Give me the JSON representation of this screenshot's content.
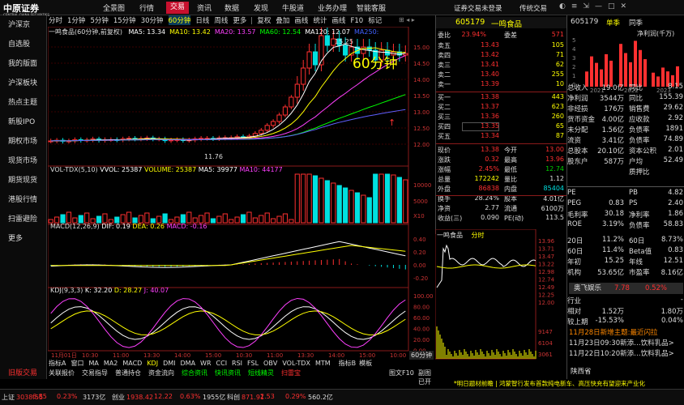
{
  "app": {
    "logo": "中原证券",
    "logo_sub": "CENTRAL CHINA SECURITIES",
    "login": "证券交易未登录",
    "sync": "传统交易"
  },
  "menu": [
    "全景图",
    "行情",
    "交易",
    "资讯",
    "数据",
    "发现",
    "牛股道",
    "业务办理",
    "智能客服"
  ],
  "menu_active": 2,
  "sidebar": [
    "沪深京",
    "自选股",
    "我的版面",
    "沪深板块",
    "热点主题",
    "新股IPO",
    "期权市场",
    "现货市场",
    "期货现货",
    "港股行情",
    "扫雷避险",
    "更多",
    "旧版交易"
  ],
  "toolbar": {
    "items": [
      "分时",
      "1分钟",
      "5分钟",
      "15分钟",
      "30分钟",
      "60分钟",
      "日线",
      "周线",
      "更多",
      "复权",
      "叠加",
      "画线",
      "统计",
      "画线",
      "F10",
      "标记"
    ],
    "selected": "60分钟"
  },
  "chart": {
    "title": "一鸣食品(60分钟,前复权)",
    "ma": [
      {
        "label": "MA5: 13.34",
        "color": "#ffffff"
      },
      {
        "label": "MA10: 13.42",
        "color": "#ffff00"
      },
      {
        "label": "MA20: 13.57",
        "color": "#ff40ff"
      },
      {
        "label": "MA60: 12.54",
        "color": "#00ff00"
      },
      {
        "label": "MA120: 12.07",
        "color": "#ffffff"
      },
      {
        "label": "MA250:",
        "color": "#4060ff"
      }
    ],
    "annotation": "60分钟",
    "high_label": "15.25",
    "low_label": "11.76",
    "y_ticks": [
      "15.00",
      "14.50",
      "14.00",
      "13.50",
      "13.00",
      "12.50",
      "12.00"
    ],
    "vol_title": "VOL-TDX(5,10)",
    "vol_vals": [
      "VVOL: 25387",
      "VOLUME: 25387",
      "MA5: 39977",
      "MA10: 44177"
    ],
    "vol_ticks": [
      "10000",
      "5000",
      "X10"
    ],
    "macd_title": "MACD(12,26,9)",
    "macd_vals": [
      "DIF: 0.19",
      "DEA: 0.26",
      "MACD: -0.16"
    ],
    "macd_ticks": [
      "0.40",
      "0.20",
      "0.00",
      "-0.20"
    ],
    "kdj_title": "KDJ(9,3,3)",
    "kdj_vals": [
      "K: 32.20",
      "D: 28.27",
      "J: 40.07"
    ],
    "kdj_ticks": [
      "100.00",
      "80.00",
      "60.00",
      "40.00",
      "20.00",
      "0.00"
    ],
    "x_labels": [
      "11月01日",
      "10:30",
      "11:00",
      "13:30",
      "14:00",
      "15:00",
      "10:30",
      "11:00",
      "13:30",
      "14:00",
      "15:00",
      "10:00"
    ],
    "period_tag": "60分钟",
    "bottom_tabs": [
      "指标A",
      "窗口",
      "MA",
      "MA2",
      "MACD",
      "KDJ",
      "DMI",
      "DMA",
      "WR",
      "CCI",
      "RSI",
      "FSL",
      "ОВV",
      "VOL-TDX",
      "MTM"
    ],
    "bottom_tabs_right": [
      "指标B",
      "模板"
    ],
    "bottom_links": [
      "关联报价",
      "交易指导",
      "普通持仓",
      "资金流向",
      "综合资讯",
      "快讯资讯",
      "短线精灵",
      "扫雷宝"
    ],
    "bottom_right": [
      "图文F10",
      "副图已开"
    ]
  },
  "quote": {
    "code": "605179",
    "name": "一鸣食品",
    "weibi": {
      "label": "委比",
      "pct": "23.94%",
      "label2": "委差",
      "val": "571"
    },
    "sell": [
      {
        "l": "卖五",
        "p": "13.43",
        "v": "105"
      },
      {
        "l": "卖四",
        "p": "13.42",
        "v": "71"
      },
      {
        "l": "卖三",
        "p": "13.41",
        "v": "62"
      },
      {
        "l": "卖二",
        "p": "13.40",
        "v": "255"
      },
      {
        "l": "卖一",
        "p": "13.39",
        "v": "10"
      }
    ],
    "buy": [
      {
        "l": "买一",
        "p": "13.38",
        "v": "443"
      },
      {
        "l": "买二",
        "p": "13.37",
        "v": "623"
      },
      {
        "l": "买三",
        "p": "13.36",
        "v": "260"
      },
      {
        "l": "买四",
        "p": "13.35",
        "v": "65"
      },
      {
        "l": "买五",
        "p": "13.34",
        "v": "87"
      }
    ],
    "stats": [
      {
        "a": "现价",
        "av": "13.38",
        "b": "今开",
        "bv": "13.00"
      },
      {
        "a": "涨跌",
        "av": "0.32",
        "b": "最高",
        "bv": "13.96"
      },
      {
        "a": "涨幅",
        "av": "2.45%",
        "b": "最低",
        "bv": "12.74"
      },
      {
        "a": "总量",
        "av": "172242",
        "b": "量比",
        "bv": "1.12"
      },
      {
        "a": "外盘",
        "av": "86838",
        "b": "内盘",
        "bv": "85404"
      },
      {
        "a": "换手",
        "av": "28.24%",
        "b": "股本",
        "bv": "4.01亿"
      },
      {
        "a": "净资",
        "av": "2.77",
        "b": "流通",
        "bv": "6100万"
      },
      {
        "a": "收益(三)",
        "av": "0.090",
        "b": "PE(动)",
        "bv": "113.5"
      }
    ],
    "mini_title": "一鸣食品",
    "mini_tag": "分时",
    "mini_ticks": [
      "13.96",
      "13.71",
      "13.47",
      "13.22",
      "12.98",
      "12.74",
      "12.49",
      "12.25",
      "12.00"
    ],
    "mini_vol_ticks": [
      "9147",
      "6104",
      "3061"
    ]
  },
  "rightpanel": {
    "code": "605179",
    "tabs": [
      "单季",
      "同季",
      "净利润(千万)"
    ],
    "bar_y": [
      "5",
      "4",
      "3",
      "2",
      "1",
      "0"
    ],
    "bar_x": [
      "2021",
      "2022",
      "2023"
    ],
    "bar_values": [
      3.4,
      4.8,
      2.0
    ],
    "fin": [
      {
        "a": "总收入",
        "av": "19.0亿",
        "b": "同比",
        "bv": "8.15"
      },
      {
        "a": "净利润",
        "av": "3544万",
        "b": "同比",
        "bv": "155.39"
      },
      {
        "a": "非经损",
        "av": "176万",
        "b": "销售费",
        "bv": "29.62"
      },
      {
        "a": "货币资金",
        "av": "4.00亿",
        "b": "应收款",
        "bv": "2.92"
      },
      {
        "a": "未分配",
        "av": "1.56亿",
        "b": "负债率",
        "bv": "1891"
      },
      {
        "a": "流资",
        "av": "3.41亿",
        "b": "负债率",
        "bv": "74.89"
      },
      {
        "a": "总股本",
        "av": "20.10亿",
        "b": "资本公积",
        "bv": "2.01"
      },
      {
        "a": "股东户",
        "av": "587万",
        "b": "户均",
        "bv": "52.49"
      },
      {
        "a": "",
        "av": "",
        "b": "质押比",
        "bv": ""
      }
    ],
    "val": [
      {
        "a": "PE",
        "av": "",
        "b": "PB",
        "bv": "4.82"
      },
      {
        "a": "PEG",
        "av": "0.83",
        "b": "PS",
        "bv": "2.40"
      },
      {
        "a": "毛利率",
        "av": "30.18",
        "b": "净利率",
        "bv": "1.86"
      },
      {
        "a": "ROE",
        "av": "3.19%",
        "b": "负债率",
        "bv": "58.83"
      }
    ],
    "perf": [
      {
        "a": "20日",
        "av": "11.2%",
        "b": "60日",
        "bv": "8.73%"
      },
      {
        "a": "60日",
        "av": "11.4%",
        "b": "Beta值",
        "bv": "0.83"
      },
      {
        "a": "年初",
        "av": "15.25",
        "b": "年线",
        "bv": "12.51"
      },
      {
        "a": "机构",
        "av": "53.65亿",
        "b": "市盈率",
        "bv": "8.16亿"
      }
    ],
    "sector": {
      "name": "奥飞娱乐",
      "price": "7.78",
      "pct": "0.52%"
    },
    "ranks": [
      {
        "a": "行业",
        "av": "",
        "b": "",
        "bv": "-"
      },
      {
        "a": "相对",
        "av": "1.52万",
        "b": "",
        "bv": "1.80万"
      },
      {
        "a": "较上期",
        "av": "-15.53%",
        "b": "",
        "bv": "0.04%"
      }
    ],
    "news": [
      "11月28日新增主题:最近闪拉",
      "11月23日09:30新添…饮料乳品>",
      "11月22日10:20新添…饮料乳品>"
    ],
    "footer": "陕西省"
  },
  "status": {
    "items": [
      {
        "l": "上证",
        "v": "3038.55",
        "c": "#ff3030"
      },
      {
        "l": "",
        "v": "6.85",
        "c": "#ff3030"
      },
      {
        "l": "",
        "v": "0.23%",
        "c": "#ff3030"
      },
      {
        "l": "",
        "v": "3173亿",
        "c": "#ddd"
      },
      {
        "l": "创业",
        "v": "1938.42",
        "c": "#ff3030"
      },
      {
        "l": "",
        "v": "12.22",
        "c": "#ff3030"
      },
      {
        "l": "",
        "v": "0.63%",
        "c": "#ff3030"
      },
      {
        "l": "",
        "v": "1955亿",
        "c": "#ddd"
      },
      {
        "l": "科创",
        "v": "871.91",
        "c": "#ff3030"
      },
      {
        "l": "",
        "v": "2.53",
        "c": "#ff3030"
      },
      {
        "l": "",
        "v": "0.29%",
        "c": "#ff3030"
      },
      {
        "l": "",
        "v": "560.2亿",
        "c": "#ddd"
      }
    ],
    "ticker": "*明日题材前瞻 | 鸿蒙智行发布首款纯电新车、高压快充有望迎来产业化"
  }
}
